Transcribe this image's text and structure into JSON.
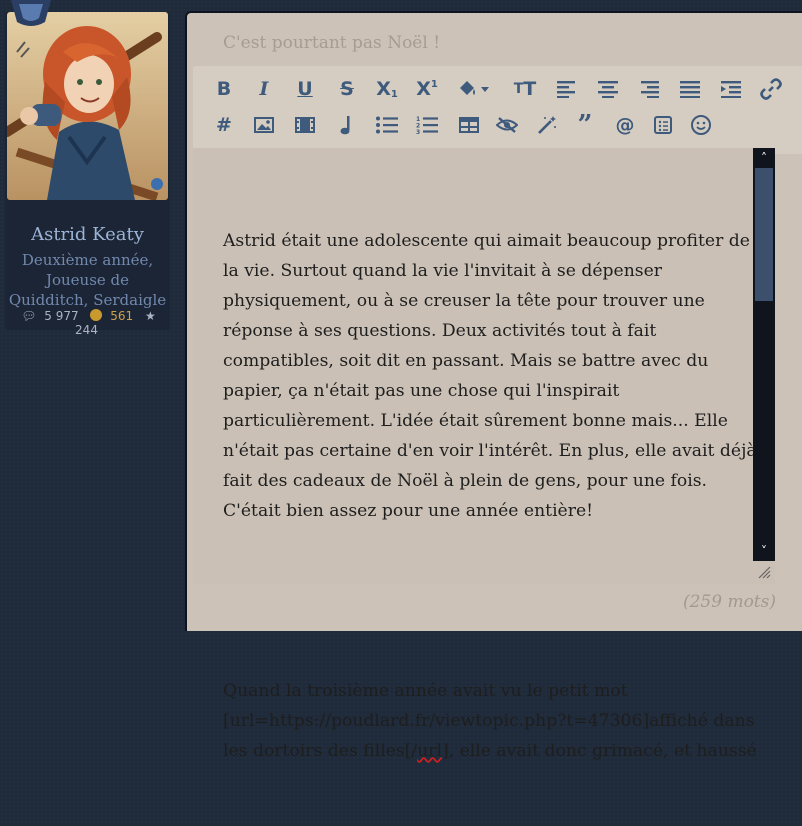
{
  "profile": {
    "name": "Astrid Keaty",
    "role_line1": "Deuxième année,",
    "role_line2": "Joueuse de",
    "role_line3": "Quidditch, Serdaigle",
    "posts": "5 977",
    "points": "561",
    "stars": "244"
  },
  "editor": {
    "subject_placeholder": "C'est pourtant pas Noël !",
    "toolbar_icons": [
      "bold-icon",
      "italic-icon",
      "underline-icon",
      "strikethrough-icon",
      "subscript-icon",
      "superscript-icon",
      "fill-color-icon",
      "font-size-icon",
      "align-left-icon",
      "align-center-icon",
      "align-right-icon",
      "justify-icon",
      "indent-icon",
      "link-icon",
      "hashtag-icon",
      "image-icon",
      "video-icon",
      "music-icon",
      "bullet-list-icon",
      "numbered-list-icon",
      "table-icon",
      "hide-icon",
      "magic-wand-icon",
      "quote-icon",
      "mention-icon",
      "spoiler-icon",
      "emoji-icon"
    ],
    "paragraph1": "Astrid était une adolescente qui aimait beaucoup profiter de la vie. Surtout quand la vie l'invitait à se dépenser physiquement, ou à se creuser la tête pour trouver une réponse à ses questions. Deux activités tout à fait compatibles, soit dit en passant. Mais se battre avec du papier, ça n'était pas une chose qui l'inspirait particulièrement. L'idée était sûrement bonne mais... Elle n'était pas certaine d'en voir l'intérêt. En plus, elle avait déjà fait des cadeaux de Noël à plein de gens, pour une fois. C'était bien assez pour une année entière!",
    "paragraph2_a": "Quand la troisième année avait vu le petit mot [url=https://poudlard.fr/viewtopic.php?t=47306]affiché dans les dortoirs des filles[/",
    "paragraph2_b": "url",
    "paragraph2_c": "], elle avait donc grimacé, et haussé",
    "word_count": "(259 mots)"
  },
  "colors": {
    "icon": "#3e5a7c",
    "panel_bg": "#ccc2b7",
    "page_bg": "#1f2a3a",
    "name": "#9cb4d6"
  }
}
